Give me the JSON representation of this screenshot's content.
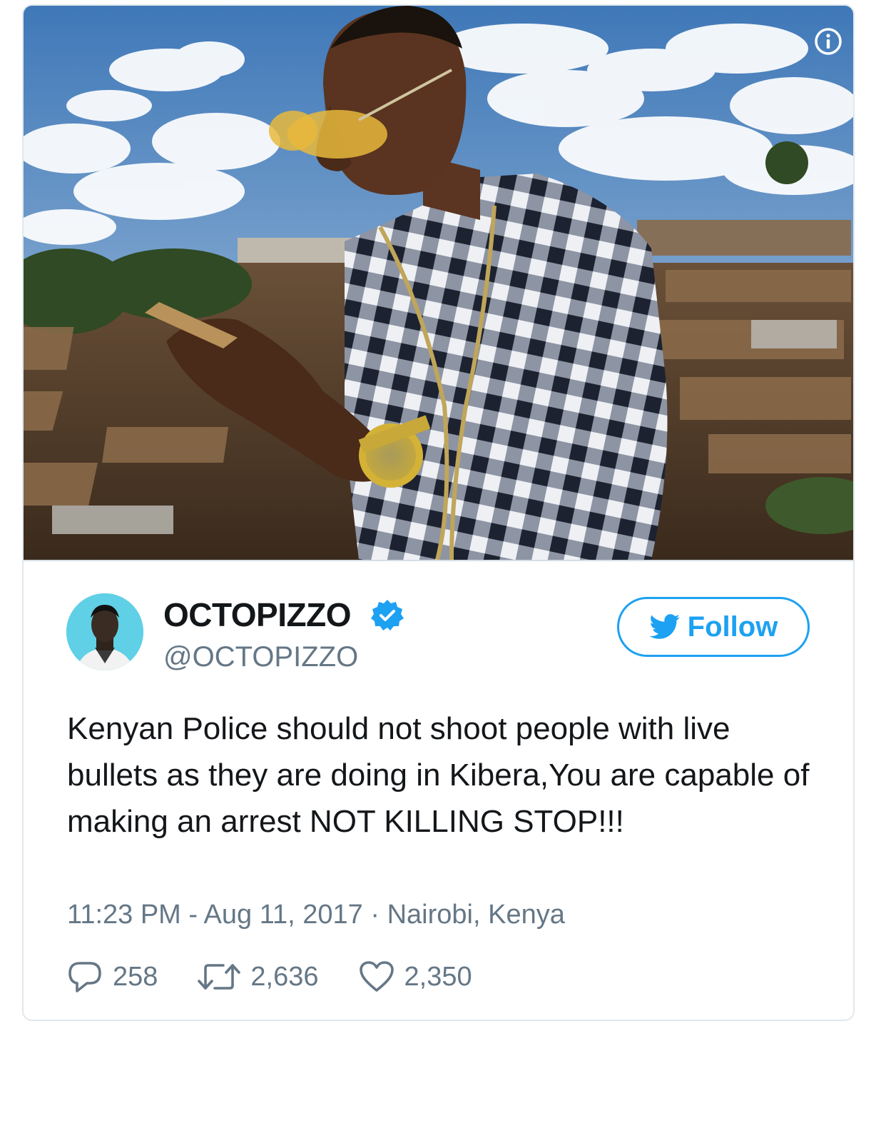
{
  "author": {
    "display_name": "OCTOPIZZO",
    "handle": "@OCTOPIZZO",
    "verified": true
  },
  "follow_button": {
    "label": "Follow"
  },
  "tweet": {
    "text": "Kenyan Police should not shoot people with live bullets as they are doing in Kibera,You are capable of making an arrest NOT KILLING STOP!!!",
    "time": "11:23 PM",
    "date": "Aug 11, 2017",
    "location": "Nairobi, Kenya"
  },
  "stats": {
    "replies": "258",
    "retweets": "2,636",
    "likes": "2,350"
  },
  "icons": {
    "info": "info-icon",
    "verified": "verified-badge-icon",
    "follow": "twitter-bird-icon",
    "reply": "reply-icon",
    "retweet": "retweet-icon",
    "like": "heart-icon"
  },
  "colors": {
    "accent": "#1da1f2",
    "text_primary": "#14171a",
    "text_secondary": "#657786",
    "border": "#e1e8ed"
  }
}
